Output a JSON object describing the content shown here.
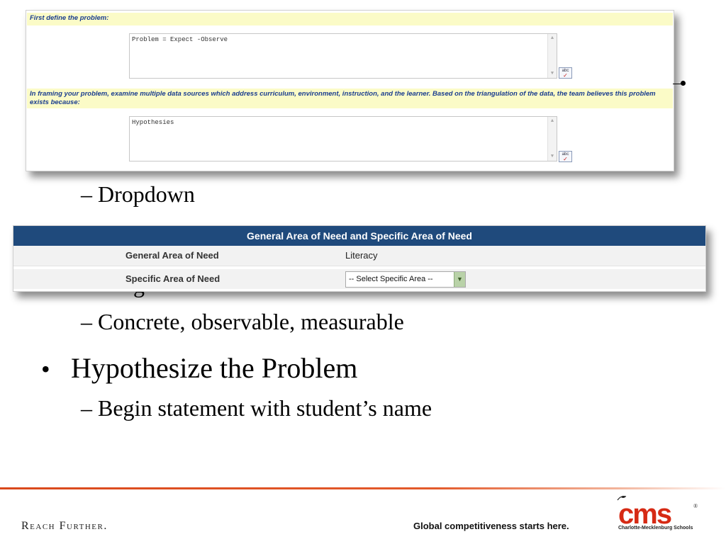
{
  "form1": {
    "prompt1": "First define the problem:",
    "textarea1_value": "Problem = Expect -Observe",
    "prompt2": "In framing your problem, examine multiple data sources which address curriculum, environment, instruction, and the learner. Based on the triangulation of the data, the team believes this problem exists because:",
    "textarea2_value": "Hypothesies",
    "spell_label": "abc"
  },
  "slide": {
    "sub1": "Dropdown",
    "partial_text": "g",
    "sub2": "Concrete, observable, measurable",
    "bullet": "Hypothesize the Problem",
    "sub3": "Begin statement with student’s name"
  },
  "form2": {
    "header": "General Area of Need and Specific Area of Need",
    "row1_label": "General Area of Need",
    "row1_value": "Literacy",
    "row2_label": "Specific Area of Need",
    "row2_select": "-- Select Specific Area --"
  },
  "footer": {
    "motto": "Reach Further.",
    "tagline": "Global competitiveness starts here.",
    "logo_text": "cms",
    "logo_reg": "®",
    "logo_sub": "Charlotte-Mecklenburg Schools"
  },
  "colors": {
    "header_blue": "#1f4a7c",
    "prompt_bg": "#fbfbc7",
    "prompt_text": "#1a3d8f",
    "brand_red": "#d62a14",
    "footer_line": "#d9481b"
  }
}
